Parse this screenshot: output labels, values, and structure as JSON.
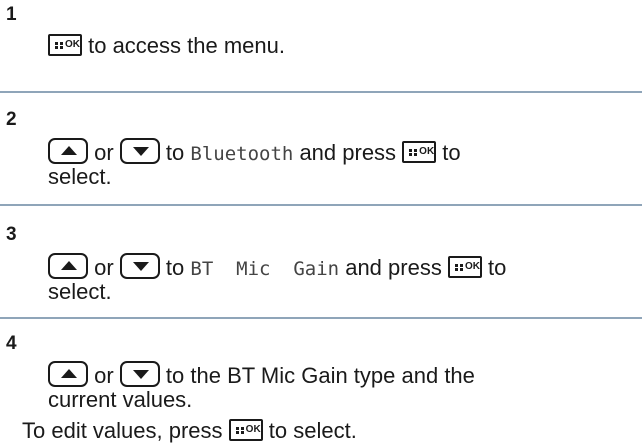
{
  "steps": [
    {
      "number": "1",
      "line1_after_ok": " to access the menu."
    },
    {
      "number": "2",
      "or": " or ",
      "to": " to ",
      "menu_item": "Bluetooth",
      "and_press": " and press ",
      "to_tail": " to",
      "line2": "select."
    },
    {
      "number": "3",
      "or": " or ",
      "to": " to ",
      "menu_item": "BT  Mic  Gain",
      "and_press": " and press ",
      "to_tail": " to",
      "line2": "select."
    },
    {
      "number": "4",
      "or": " or ",
      "line1_rest": " to the BT Mic Gain type and the",
      "line2": "current values.",
      "note_before": "To edit values, press ",
      "note_after": " to select."
    }
  ],
  "buttons": {
    "ok_label": "OK",
    "ok_icon": "menu-ok-icon",
    "up_icon": "up-arrow-icon",
    "down_icon": "down-arrow-icon"
  },
  "colors": {
    "rule": "#8fa5b9",
    "text": "#1a1a1a"
  }
}
